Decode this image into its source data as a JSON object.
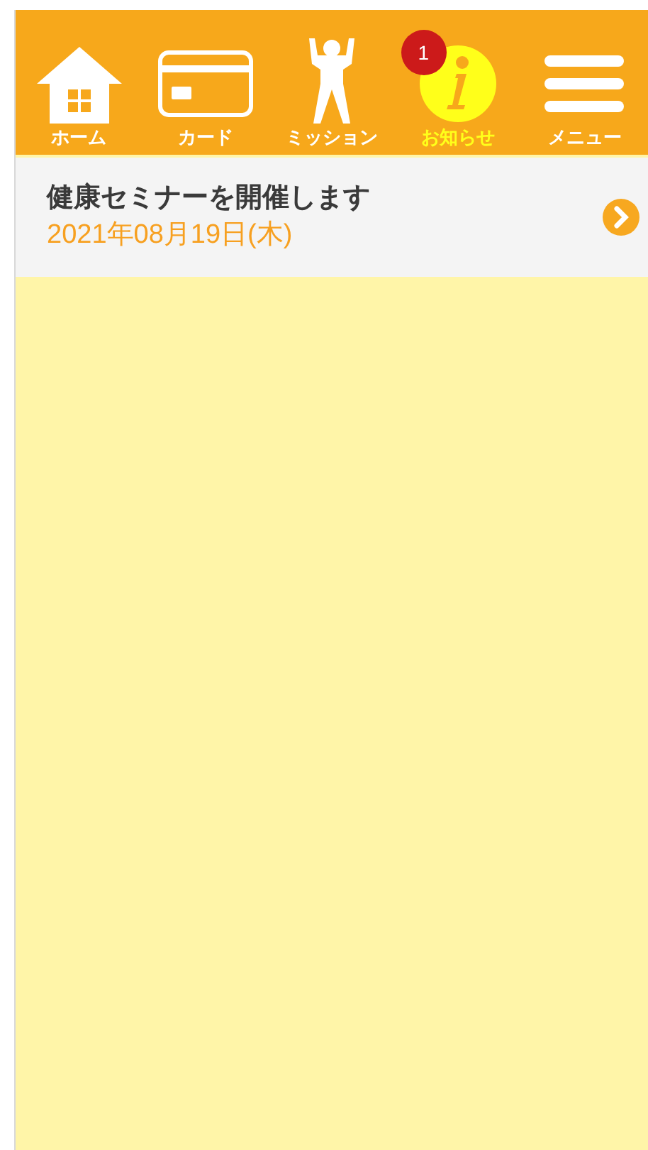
{
  "nav": [
    {
      "kind": "home",
      "label": "ホーム",
      "selected": false
    },
    {
      "kind": "card",
      "label": "カード",
      "selected": false
    },
    {
      "kind": "mission",
      "label": "ミッション",
      "selected": false
    },
    {
      "kind": "info",
      "label": "お知らせ",
      "selected": true,
      "badge": "1"
    },
    {
      "kind": "menu",
      "label": "メニュー",
      "selected": false
    }
  ],
  "news": [
    {
      "title": "健康セミナーを開催します",
      "date": "2021年08月19日(木)"
    }
  ]
}
